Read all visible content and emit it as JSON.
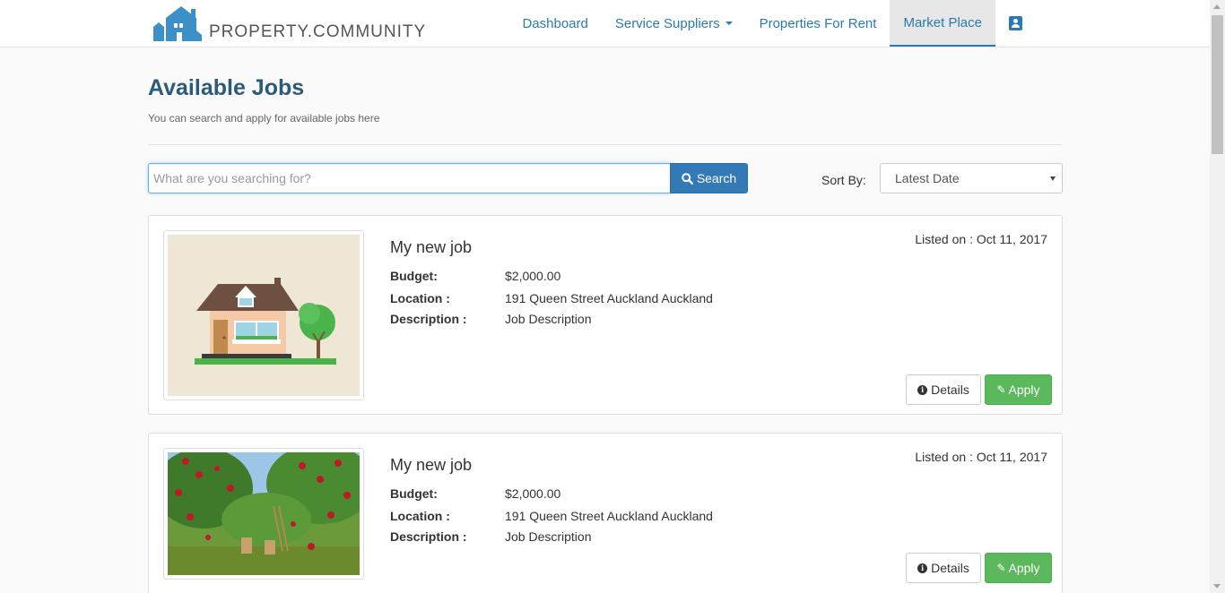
{
  "navbar": {
    "brand": "PROPERTY.COMMUNITY",
    "items": [
      {
        "label": "Dashboard"
      },
      {
        "label": "Service Suppliers"
      },
      {
        "label": "Properties For Rent"
      },
      {
        "label": "Market Place"
      }
    ],
    "active_item": "Market Place",
    "profile_icon": "contact-card-icon"
  },
  "header": {
    "title": "Available Jobs",
    "subtitle": "You can search and apply for available jobs here"
  },
  "search": {
    "placeholder": "What are you searching for?",
    "value": "",
    "button_label": "Search",
    "button_icon": "search-icon"
  },
  "sort": {
    "label": "Sort By:",
    "selected": "Latest Date"
  },
  "jobs": [
    {
      "title": "My new job",
      "listed_label": "Listed on : ",
      "listed_date": "Oct 11, 2017",
      "budget_label": "Budget:",
      "budget": "$2,000.00",
      "location_label": "Location :",
      "location": "191 Queen Street Auckland Auckland",
      "description_label": "Description :",
      "description": "Job Description",
      "image": "house-illustration",
      "details_label": "Details",
      "apply_label": "Apply"
    },
    {
      "title": "My new job",
      "listed_label": "Listed on : ",
      "listed_date": "Oct 11, 2017",
      "budget_label": "Budget:",
      "budget": "$2,000.00",
      "location_label": "Location :",
      "location": "191 Queen Street Auckland Auckland",
      "description_label": "Description :",
      "description": "Job Description",
      "image": "apple-orchard-photo",
      "details_label": "Details",
      "apply_label": "Apply"
    }
  ],
  "colors": {
    "link": "#2a7ab0",
    "title": "#2c5b7a",
    "primary": "#337ab7",
    "success": "#5cb85c"
  }
}
